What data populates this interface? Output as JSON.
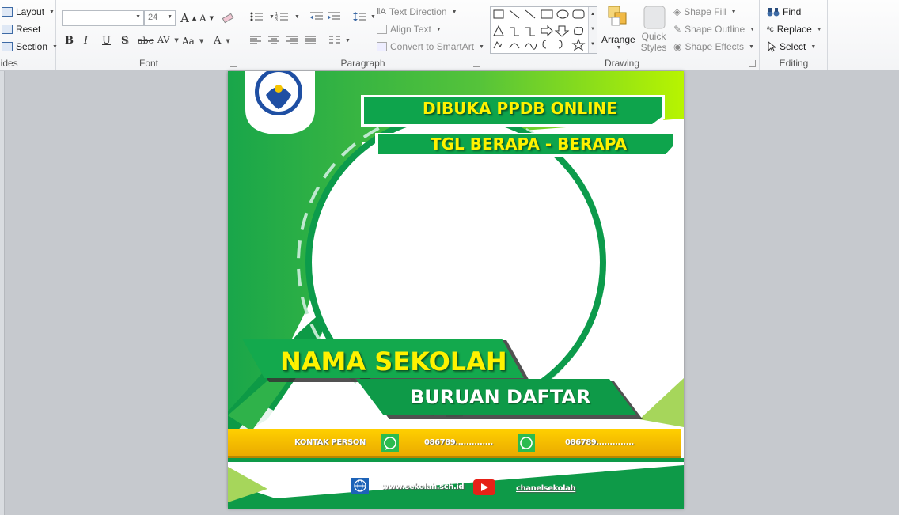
{
  "ribbon": {
    "slides_group": {
      "label": "lides",
      "layout": "Layout",
      "reset": "Reset",
      "section": "Section"
    },
    "font_group": {
      "label": "Font",
      "font_name": "",
      "font_size": "24"
    },
    "paragraph_group": {
      "label": "Paragraph",
      "text_direction": "Text Direction",
      "align_text": "Align Text",
      "convert_smartart": "Convert to SmartArt"
    },
    "drawing_group": {
      "label": "Drawing",
      "arrange": "Arrange",
      "quick_styles_1": "Quick",
      "quick_styles_2": "Styles",
      "shape_fill": "Shape Fill",
      "shape_outline": "Shape Outline",
      "shape_effects": "Shape Effects"
    },
    "editing_group": {
      "label": "Editing",
      "find": "Find",
      "replace": "Replace",
      "select": "Select"
    }
  },
  "slide": {
    "banner_top": "DIBUKA PPDB ONLINE",
    "banner_dates": "TGL BERAPA - BERAPA",
    "school_name": "NAMA SEKOLAH",
    "call_to_action": "BURUAN DAFTAR",
    "contact_label": "KONTAK PERSON",
    "phone_1": "086789..............",
    "phone_2": "086789..............",
    "website": "www.sekolah.sch.id",
    "channel": "chanelsekolah"
  },
  "colors": {
    "green_dark": "#0e9a48",
    "green_light": "#5cc63a",
    "lime": "#b5f200",
    "yellow_bar": "#f5c400",
    "title_yellow": "#fff200"
  }
}
